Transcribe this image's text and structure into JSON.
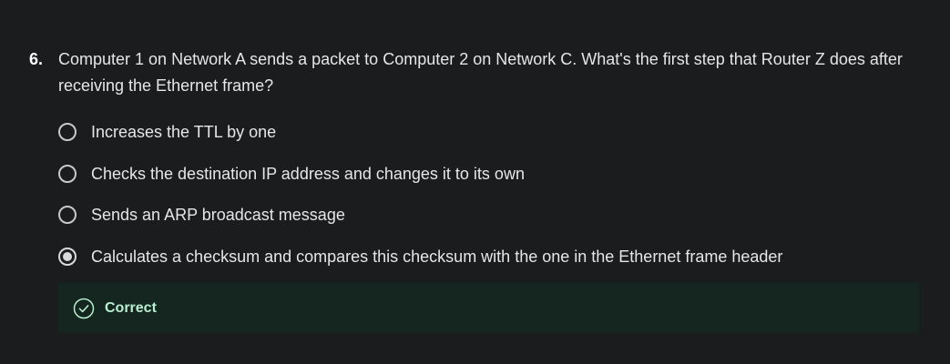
{
  "question": {
    "number": "6.",
    "text": "Computer 1 on Network A sends a packet to Computer 2 on Network C. What's the first step that Router Z does after receiving the Ethernet frame?"
  },
  "options": [
    {
      "label": "Increases the TTL by one",
      "selected": false
    },
    {
      "label": "Checks the destination IP address and changes it to its own",
      "selected": false
    },
    {
      "label": "Sends an ARP broadcast message",
      "selected": false
    },
    {
      "label": "Calculates a checksum and compares this checksum with the one in the Ethernet frame header",
      "selected": true
    }
  ],
  "feedback": {
    "label": "Correct",
    "icon": "check-circle-icon",
    "color": "#b8f0cf"
  }
}
